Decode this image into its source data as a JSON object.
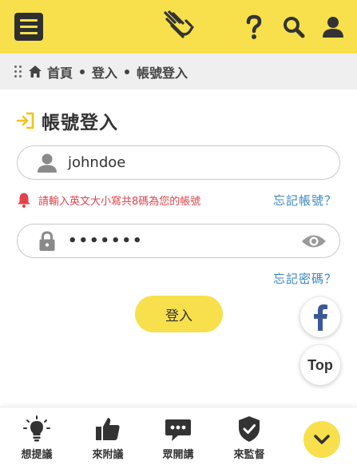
{
  "header": {
    "menu_icon": "hamburger-icon",
    "logo_icon": "waving-hands-logo",
    "help_icon": "question-mark-icon",
    "search_icon": "search-icon",
    "user_icon": "user-icon",
    "background_color": "#f7e04b"
  },
  "breadcrumb": {
    "home_label": "首頁",
    "login_label": "登入",
    "current_label": "帳號登入"
  },
  "page_title": "帳號登入",
  "form": {
    "username_value": "johndoe",
    "username_hint": "請輸入英文大小寫共8碼為您的帳號",
    "forgot_account_label": "忘記帳號？",
    "password_value": "•••••••",
    "forgot_password_label": "忘記密碼？",
    "login_button_label": "登入"
  },
  "floating": {
    "facebook_icon": "facebook-icon",
    "top_label": "Top"
  },
  "bottom_nav": [
    {
      "label": "想提議",
      "icon": "lightbulb-icon"
    },
    {
      "label": "來附議",
      "icon": "thumbs-up-icon"
    },
    {
      "label": "眾開講",
      "icon": "chat-bubble-icon"
    },
    {
      "label": "來監督",
      "icon": "shield-check-icon"
    }
  ],
  "colors": {
    "accent": "#f7e04b",
    "link": "#3b86c6",
    "warning": "#e2434a"
  }
}
